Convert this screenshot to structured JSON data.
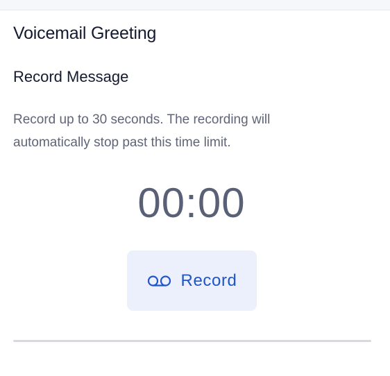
{
  "voicemail": {
    "title": "Voicemail Greeting",
    "section_title": "Record Message",
    "description": "Record up to 30 seconds. The recording will automatically stop past this time limit.",
    "timer": "00:00",
    "record_button": {
      "label": "Record",
      "icon": "voicemail-icon"
    }
  },
  "colors": {
    "accent": "#1e55c8",
    "button_background": "#ecf0fd",
    "text_primary": "#141a30",
    "text_muted": "#5f6478",
    "divider": "#d8d9de"
  }
}
